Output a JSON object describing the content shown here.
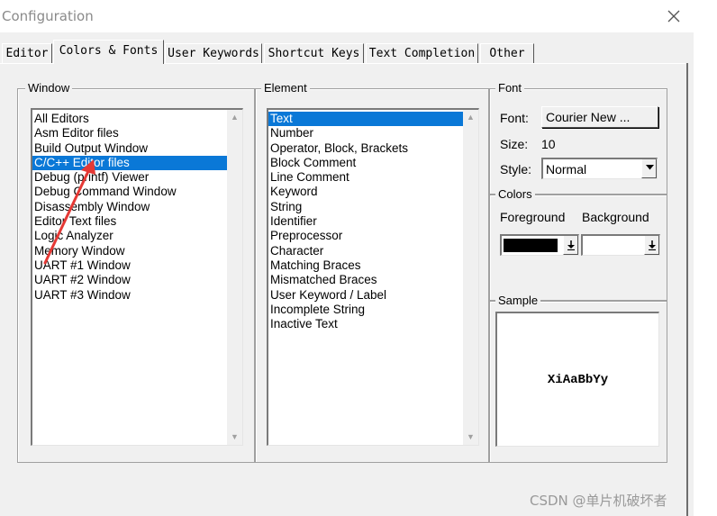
{
  "window": {
    "title": "Configuration",
    "close_icon": "close-icon"
  },
  "tabs": [
    {
      "label": "Editor"
    },
    {
      "label": "Colors & Fonts"
    },
    {
      "label": "User Keywords"
    },
    {
      "label": "Shortcut Keys"
    },
    {
      "label": "Text Completion"
    },
    {
      "label": "Other"
    }
  ],
  "active_tab": "Colors & Fonts",
  "window_group": {
    "label": "Window",
    "items": [
      "All Editors",
      "Asm Editor files",
      "Build Output Window",
      "C/C++ Editor files",
      "Debug (printf) Viewer",
      "Debug Command Window",
      "Disassembly Window",
      "Editor Text files",
      "Logic Analyzer",
      "Memory Window",
      "UART #1 Window",
      "UART #2 Window",
      "UART #3 Window"
    ],
    "selected": "C/C++ Editor files"
  },
  "element_group": {
    "label": "Element",
    "items": [
      "Text",
      "Number",
      "Operator, Block, Brackets",
      "Block Comment",
      "Line Comment",
      "Keyword",
      "String",
      "Identifier",
      "Preprocessor",
      "Character",
      "Matching Braces",
      "Mismatched Braces",
      "User Keyword / Label",
      "Incomplete String",
      "Inactive Text"
    ],
    "selected": "Text"
  },
  "font_group": {
    "label": "Font",
    "font_label": "Font:",
    "font_button": "Courier New ...",
    "size_label": "Size:",
    "size_value": "10",
    "style_label": "Style:",
    "style_value": "Normal"
  },
  "colors_group": {
    "label": "Colors",
    "foreground_label": "Foreground",
    "background_label": "Background",
    "foreground_color": "#000000",
    "background_color": "#ffffff"
  },
  "sample_group": {
    "label": "Sample",
    "text": "XiAaBbYy"
  },
  "annotation": {
    "arrow_color": "#e53935"
  },
  "watermark": "CSDN @单片机破坏者",
  "colors": {
    "selection": "#0a78d7",
    "dialog_bg": "#f0f0f0"
  }
}
